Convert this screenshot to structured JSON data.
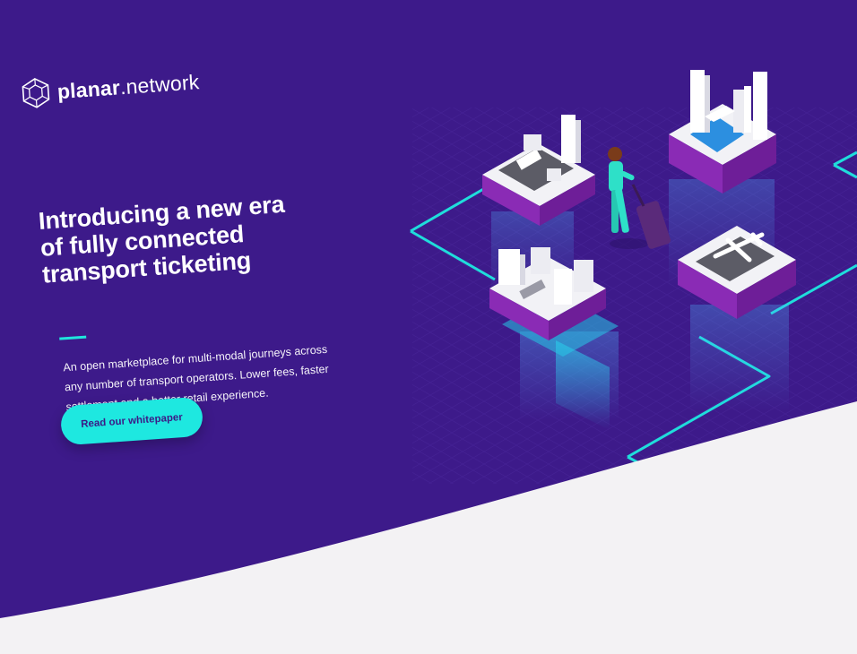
{
  "brand": {
    "name_strong": "planar",
    "name_light": ".network",
    "logo_icon": "hexagon-network-icon"
  },
  "hero": {
    "headline": [
      "Introducing a new era",
      "of fully connected",
      "transport ticketing"
    ],
    "description": [
      "An open marketplace for multi-modal journeys across",
      "any number of transport operators. Lower fees, faster",
      "settlement and a better retail experience."
    ],
    "cta_label": "Read our whitepaper"
  },
  "illustration": {
    "blocks": [
      "bus-station",
      "harbour",
      "train-station",
      "airport"
    ],
    "figure": "traveller-with-suitcase"
  },
  "colors": {
    "background": "#3d1a8a",
    "accent": "#1ee8e0",
    "block_side": "#8a2bb5",
    "bottom_curve": "#f3f2f4"
  }
}
